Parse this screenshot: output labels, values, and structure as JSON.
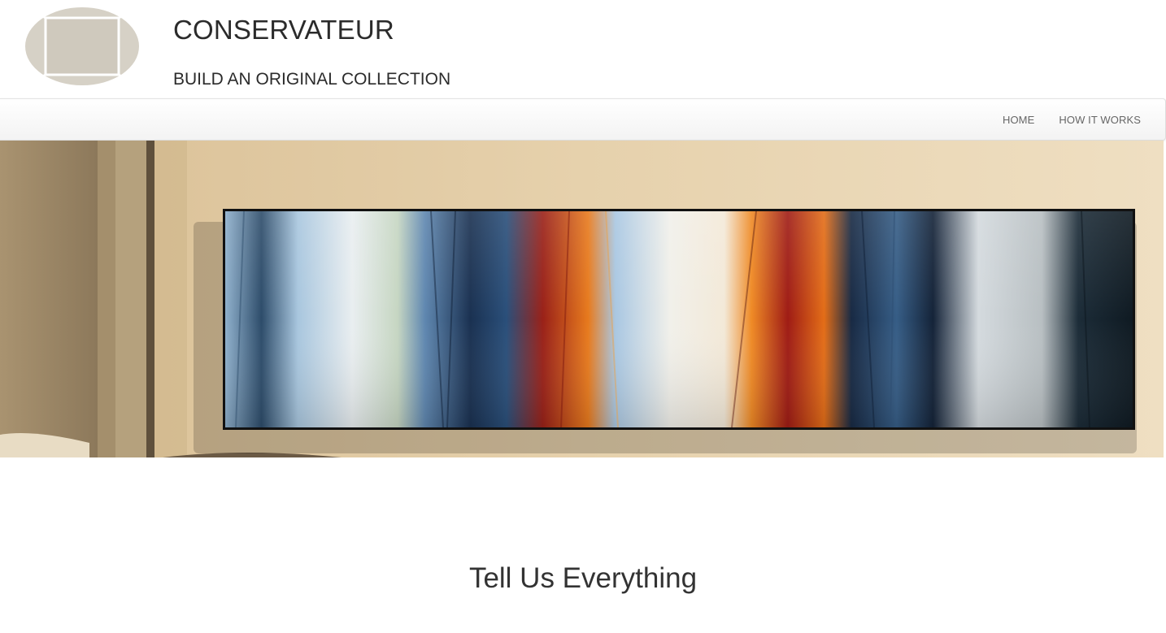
{
  "header": {
    "title": "CONSERVATEUR",
    "tagline": "BUILD AN ORIGINAL COLLECTION",
    "logo_icon": "frame-logo-icon",
    "logo_color": "#d6d1c6"
  },
  "nav": {
    "items": [
      {
        "label": "HOME"
      },
      {
        "label": "HOW IT WORKS"
      }
    ]
  },
  "hero": {
    "image": "abstract-painting-on-wall",
    "wall_color": "#e4cfaa",
    "palette": [
      "#1d3552",
      "#8fb5d6",
      "#a5231b",
      "#e97d1c",
      "#f2eee4",
      "#14222e"
    ]
  },
  "section": {
    "title": "Tell Us Everything"
  }
}
